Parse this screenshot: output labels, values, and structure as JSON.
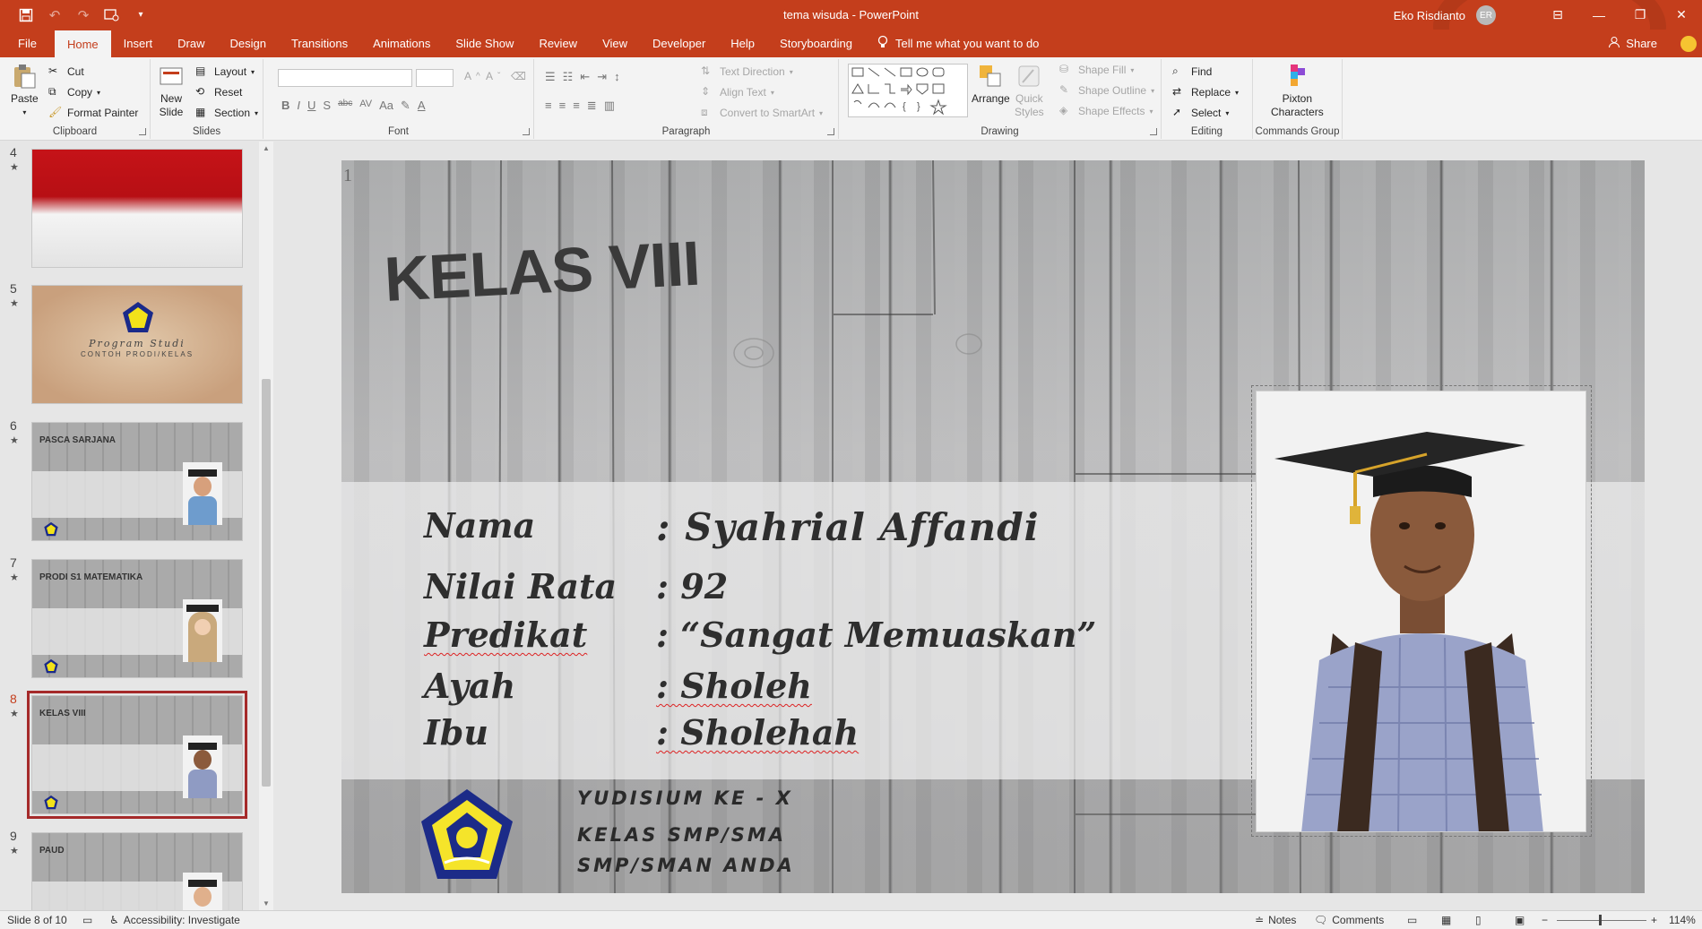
{
  "window": {
    "title": "tema wisuda  -  PowerPoint",
    "user_name": "Eko Risdianto",
    "user_initials": "ER"
  },
  "tabs": [
    "File",
    "Home",
    "Insert",
    "Draw",
    "Design",
    "Transitions",
    "Animations",
    "Slide Show",
    "Review",
    "View",
    "Developer",
    "Help",
    "Storyboarding"
  ],
  "active_tab": "Home",
  "tell_me": "Tell me what you want to do",
  "share_label": "Share",
  "ribbon": {
    "clipboard": {
      "paste": "Paste",
      "cut": "Cut",
      "copy": "Copy",
      "format_painter": "Format Painter",
      "label": "Clipboard"
    },
    "slides": {
      "new_slide_1": "New",
      "new_slide_2": "Slide",
      "layout": "Layout",
      "reset": "Reset",
      "section": "Section",
      "label": "Slides"
    },
    "font": {
      "label": "Font",
      "buttons": [
        "B",
        "I",
        "U",
        "S",
        "abc",
        "AV",
        "Aa"
      ]
    },
    "paragraph": {
      "text_direction": "Text Direction",
      "align_text": "Align Text",
      "convert_smartart": "Convert to SmartArt",
      "label": "Paragraph"
    },
    "drawing": {
      "arrange": "Arrange",
      "quick_styles_1": "Quick",
      "quick_styles_2": "Styles",
      "shape_fill": "Shape Fill",
      "shape_outline": "Shape Outline",
      "shape_effects": "Shape Effects",
      "label": "Drawing"
    },
    "editing": {
      "find": "Find",
      "replace": "Replace",
      "select": "Select",
      "label": "Editing"
    },
    "pixton": {
      "name_1": "Pixton",
      "name_2": "Characters",
      "label": "Commands Group"
    }
  },
  "thumbnails": [
    {
      "number": "4",
      "kind": "flag"
    },
    {
      "number": "5",
      "kind": "prodi",
      "line1": "Program Studi",
      "line2": "CONTOH PRODI/KELAS"
    },
    {
      "number": "6",
      "kind": "student",
      "heading": "PASCA SARJANA"
    },
    {
      "number": "7",
      "kind": "student",
      "heading": "PRODI S1 MATEMATIKA"
    },
    {
      "number": "8",
      "kind": "student",
      "heading": "KELAS VIII",
      "selected": true
    },
    {
      "number": "9",
      "kind": "student",
      "heading": "PAUD"
    }
  ],
  "slide": {
    "number": "1",
    "title": "KELAS VIII",
    "fields": [
      {
        "label": "Nama",
        "value": ": Syahrial Affandi"
      },
      {
        "label": "Nilai Rata",
        "value": ": 92"
      },
      {
        "label": "Predikat",
        "value": ": “Sangat Memuaskan”"
      },
      {
        "label": "Ayah",
        "value": ": Sholeh"
      },
      {
        "label": "Ibu",
        "value": ": Sholehah"
      }
    ],
    "footer_lines": [
      "YUDISIUM KE - X",
      "KELAS SMP/SMA",
      "SMP/SMAN ANDA"
    ]
  },
  "status": {
    "slide_of": "Slide 8 of 10",
    "accessibility": "Accessibility: Investigate",
    "notes": "Notes",
    "comments": "Comments",
    "zoom": "114%"
  },
  "colors": {
    "accent": "#c43e1c",
    "ribbon_bg": "#f3f3f3",
    "selection": "#a52a2a"
  }
}
